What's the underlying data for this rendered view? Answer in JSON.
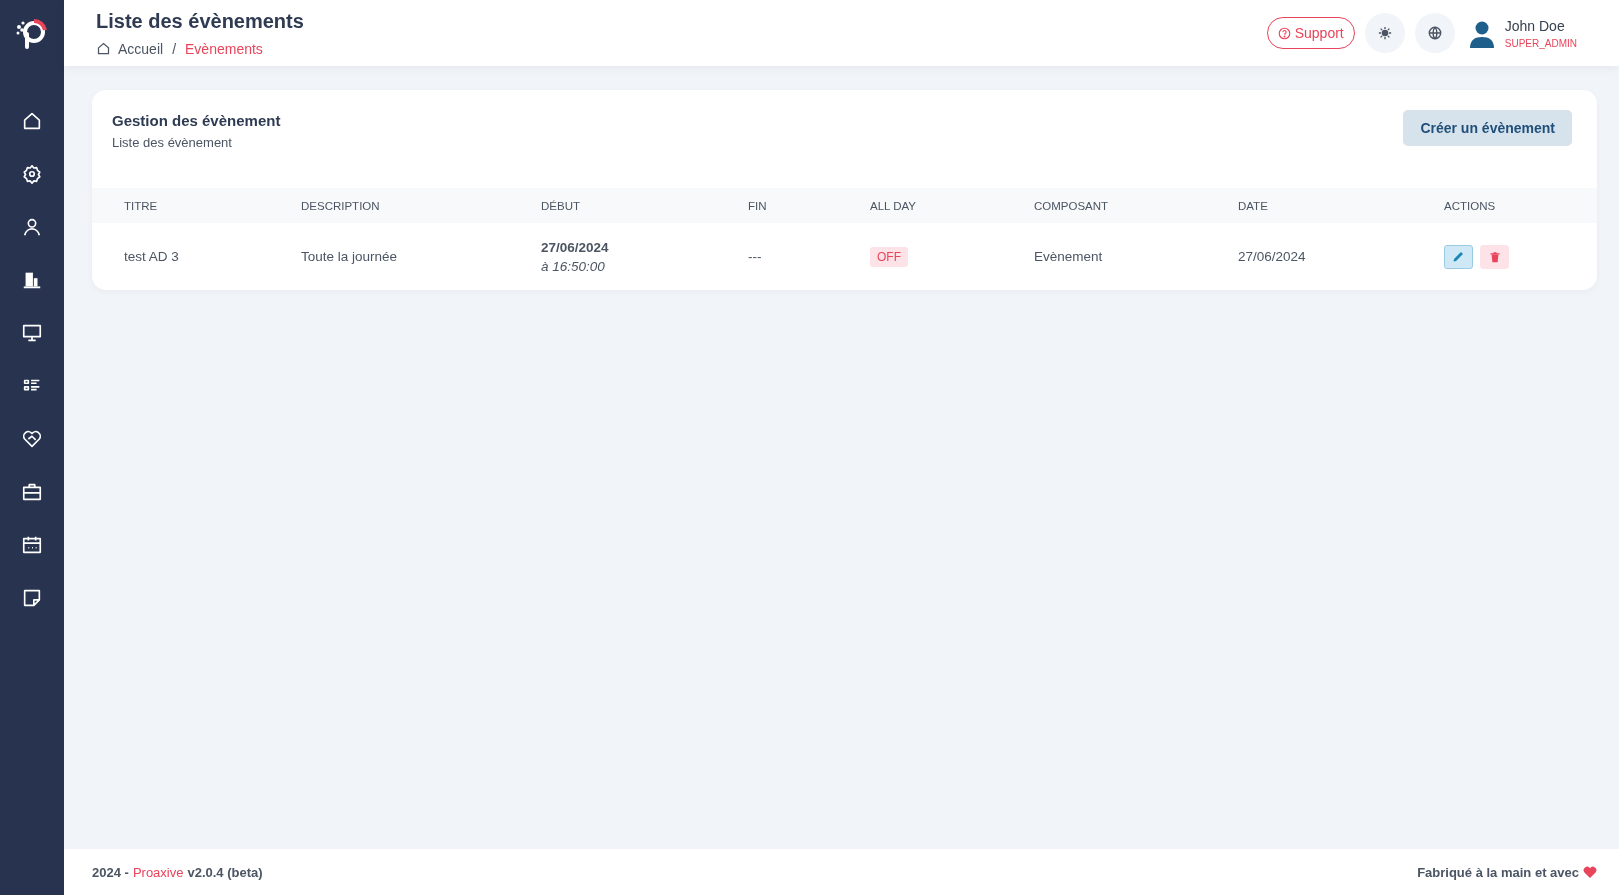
{
  "header": {
    "title": "Liste des évènements",
    "breadcrumb_separator": "/",
    "breadcrumb": [
      {
        "label": "Accueil",
        "current": false
      },
      {
        "label": "Evènements",
        "current": true
      }
    ],
    "support": "Support",
    "user": {
      "name": "John Doe",
      "role": "SUPER_ADMIN"
    }
  },
  "card": {
    "title": "Gestion des évènement",
    "subtitle": "Liste des évènement",
    "create_button": "Créer un évènement",
    "table": {
      "columns": [
        "TITRE",
        "DESCRIPTION",
        "DÉBUT",
        "FIN",
        "ALL DAY",
        "COMPOSANT",
        "DATE",
        "ACTIONS"
      ],
      "rows": [
        {
          "title": "test AD 3",
          "description": "Toute la journée",
          "start_date": "27/06/2024",
          "start_time": "à 16:50:00",
          "end": "---",
          "all_day": {
            "label": "OFF",
            "on": false
          },
          "component": "Evènement",
          "date": "27/06/2024"
        }
      ]
    }
  },
  "footer": {
    "year": "2024 -",
    "brand": "Proaxive",
    "version": "v2.0.4 (beta)",
    "made_with": "Fabriqué à la main et avec"
  }
}
